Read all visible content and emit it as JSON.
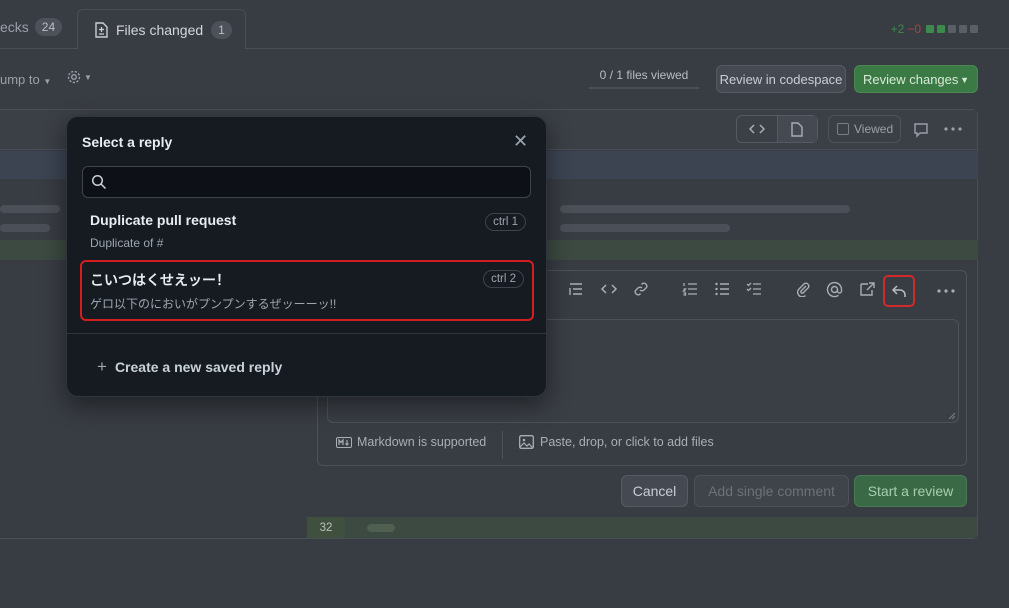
{
  "tabs": {
    "checks_label": "ecks",
    "checks_count": "24",
    "files_label": "Files changed",
    "files_count": "1"
  },
  "diffstat": {
    "additions": "+2",
    "deletions": "−0"
  },
  "toolbar": {
    "jump_to": "ump to",
    "files_viewed": "0 / 1 files viewed",
    "review_in_codespace": "Review in codespace",
    "review_changes": "Review changes"
  },
  "file_header": {
    "viewed_label": "Viewed"
  },
  "comment": {
    "markdown_label": "Markdown is supported",
    "paste_label": "Paste, drop, or click to add files",
    "cancel": "Cancel",
    "add_single": "Add single comment",
    "start_review": "Start a review"
  },
  "diff": {
    "line_number": "32"
  },
  "modal": {
    "title": "Select a reply",
    "search_value": "",
    "replies": [
      {
        "name": "Duplicate pull request",
        "body": "Duplicate of #",
        "shortcut": "ctrl 1"
      },
      {
        "name": "こいつはくせえッー！",
        "body": "ゲロ以下のにおいがプンプンするぜッーーッ!!",
        "shortcut": "ctrl 2"
      }
    ],
    "create_label": "Create a new saved reply"
  },
  "colors": {
    "primary_green": "#3c7a45",
    "highlight_red": "#d11f1f",
    "modal_bg": "#161b22"
  }
}
